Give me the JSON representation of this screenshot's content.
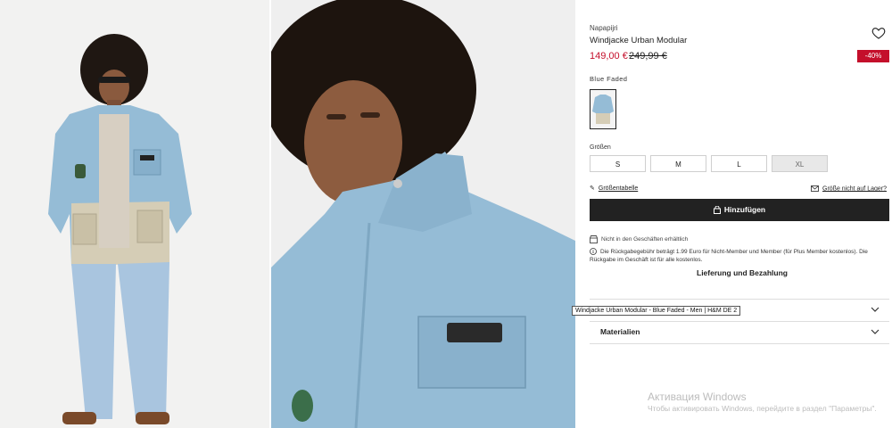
{
  "product": {
    "brand": "Napapijri",
    "title": "Windjacke Urban Modular",
    "price_current": "149,00 €",
    "price_original": "249,99 €",
    "discount_badge": "-40%",
    "color_name": "Blue Faded"
  },
  "sizes": {
    "label": "Größen",
    "options": [
      "S",
      "M",
      "L",
      "XL"
    ]
  },
  "links": {
    "size_guide": "Größentabelle",
    "size_not_in_stock": "Größe nicht auf Lager?"
  },
  "cart": {
    "add_label": "Hinzufügen"
  },
  "info": {
    "store_availability": "Nicht in den Geschäften erhältlich",
    "return_fee": "Die Rückgabegebühr beträgt 1.99 Euro für Nicht-Member und Member (für Plus Member kostenlos). Die Rückgabe im Geschäft ist für alle kostenlos.",
    "delivery_payment": "Lieferung und Bezahlung"
  },
  "tooltip": "Windjacke Urban Modular - Blue Faded - Men | H&M DE 2",
  "accordion": {
    "materials": "Materialien"
  },
  "windows_watermark": {
    "title": "Активация Windows",
    "subtitle": "Чтобы активировать Windows, перейдите в раздел \"Параметры\"."
  },
  "colors": {
    "sale_red": "#c40f2b",
    "jacket_blue": "#95bcd6",
    "button_dark": "#222222"
  }
}
